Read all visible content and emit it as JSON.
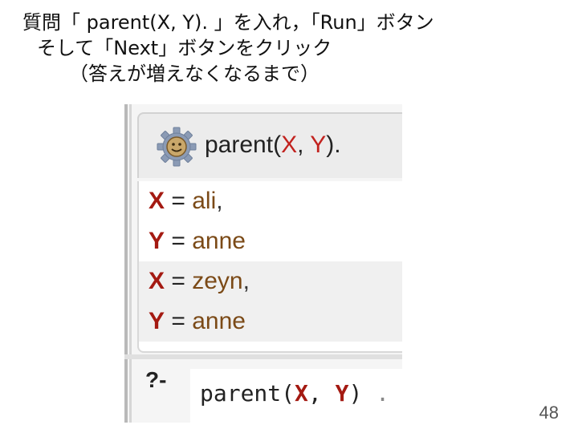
{
  "instructions": {
    "line1": "質問「 parent(X, Y). 」を入れ，「Run」ボタン",
    "line2": "そして「Next」ボタンをクリック",
    "line3": "（答えが増えなくなるまで）"
  },
  "query_panel": {
    "predicate": "parent",
    "open_paren": "(",
    "arg1": "X",
    "sep": ", ",
    "arg2": "Y",
    "close": ")."
  },
  "answers": [
    {
      "var": "X",
      "eq": " = ",
      "value": "ali",
      "trail": ","
    },
    {
      "var": "Y",
      "eq": " = ",
      "value": "anne",
      "trail": ""
    },
    {
      "var": "X",
      "eq": " = ",
      "value": "zeyn",
      "trail": ","
    },
    {
      "var": "Y",
      "eq": " = ",
      "value": "anne",
      "trail": ""
    }
  ],
  "input": {
    "prompt": "?-",
    "predicate": "parent",
    "open_paren": "(",
    "arg1": "X",
    "sep": ",  ",
    "arg2": "Y",
    "close": ")",
    "period": " ."
  },
  "page_number": "48",
  "colors": {
    "variable": "#a41a12",
    "value": "#7b4a17",
    "row_shade": "#f0f0f0"
  },
  "icons": {
    "query_icon": "gear-smiley-icon"
  }
}
